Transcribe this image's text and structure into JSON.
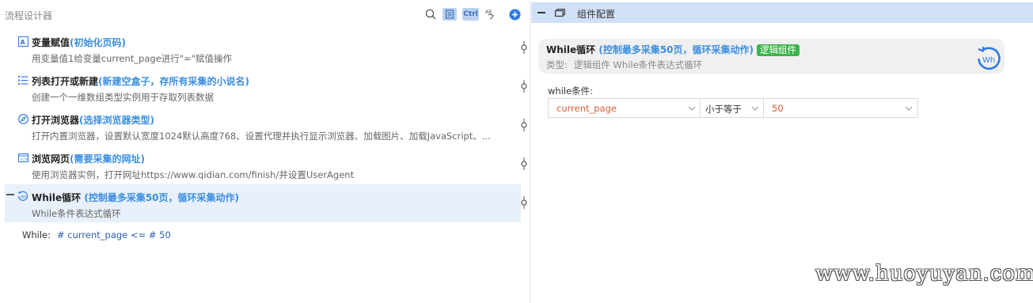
{
  "designer": {
    "title": "流程设计器",
    "toolbar": {
      "search_icon": "search-icon",
      "doc_icon": "document-icon",
      "ctrl_label": "Ctrl",
      "ab_icon": "ab-icon",
      "add_icon": "add-icon"
    },
    "steps": [
      {
        "name": "变量赋值",
        "note": "(初始化页码)",
        "desc": "用变量值1给变量current_page进行\"=\"赋值操作",
        "icon": "variable-icon"
      },
      {
        "name": "列表打开或新建",
        "note": "(新建空盒子，存所有采集的小说名)",
        "desc": "创建一个一维数组类型实例用于存取列表数据",
        "icon": "list-icon"
      },
      {
        "name": "打开浏览器",
        "note": "(选择浏览器类型)",
        "desc": "打开内置浏览器，设置默认宽度1024默认高度768、设置代理并执行显示浏览器、加载图片、加载JavaScript、...",
        "icon": "browser-icon"
      },
      {
        "name": "浏览网页",
        "note": "(需要采集的网址)",
        "desc": "使用浏览器实例，打开网址https://www.qidian.com/finish/并设置UserAgent",
        "icon": "web-icon"
      },
      {
        "name": "While循环",
        "note": " (控制最多采集50页，循环采集动作)",
        "desc": "While条件表达式循环",
        "icon": "loop-icon"
      }
    ],
    "while_condition": {
      "label": "While:",
      "expr": "# current_page <= # 50"
    }
  },
  "config": {
    "title": "组件配置",
    "card": {
      "name": "While循环",
      "note": " (控制最多采集50页，循环采集动作)",
      "badge": "逻辑组件",
      "type_label": "类型:",
      "type_value": "逻辑组件 While条件表达式循环",
      "icon": "while-loop-icon"
    },
    "field_label": "while条件:",
    "left_operand": "current_page",
    "operator": "小于等于",
    "right_operand": "50"
  },
  "watermark": "www.huoyuyan.com",
  "colors": {
    "accent": "#3b8ee0",
    "header_bg": "#cfe0f7",
    "badge": "#3ab54a",
    "value": "#d9603b"
  }
}
